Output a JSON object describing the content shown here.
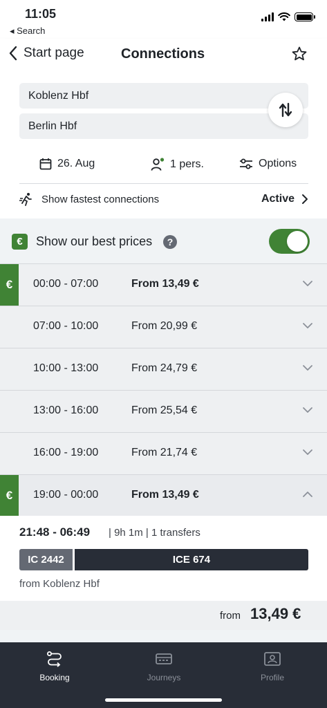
{
  "status_bar": {
    "time": "11:05",
    "back_app": "◂ Search"
  },
  "header": {
    "back_label": "Start page",
    "title": "Connections",
    "from_station": "Koblenz Hbf",
    "to_station": "Berlin Hbf",
    "date": "26. Aug",
    "passengers": "1 pers.",
    "options": "Options",
    "fastest_label": "Show fastest connections",
    "fastest_status": "Active"
  },
  "best_prices": {
    "label": "Show our best prices",
    "help": "?",
    "euro_symbol": "€",
    "enabled": true
  },
  "slots": [
    {
      "range": "00:00 - 07:00",
      "price": "From 13,49 €",
      "best": true,
      "open": false
    },
    {
      "range": "07:00 - 10:00",
      "price": "From 20,99 €",
      "best": false,
      "open": false
    },
    {
      "range": "10:00 - 13:00",
      "price": "From 24,79 €",
      "best": false,
      "open": false
    },
    {
      "range": "13:00 - 16:00",
      "price": "From 25,54 €",
      "best": false,
      "open": false
    },
    {
      "range": "16:00 - 19:00",
      "price": "From 21,74 €",
      "best": false,
      "open": false
    },
    {
      "range": "19:00 - 00:00",
      "price": "From 13,49 €",
      "best": true,
      "open": true
    }
  ],
  "connection": {
    "times": "21:48 - 06:49",
    "meta": "| 9h 1m | 1 transfers",
    "train1": "IC 2442",
    "train2": "ICE 674",
    "from": "from Koblenz Hbf",
    "price_prefix": "from",
    "price": "13,49 €"
  },
  "tabs": {
    "booking": "Booking",
    "journeys": "Journeys",
    "profile": "Profile"
  },
  "colors": {
    "accent_green": "#408335",
    "dark": "#282d37",
    "grey_train": "#646973"
  }
}
